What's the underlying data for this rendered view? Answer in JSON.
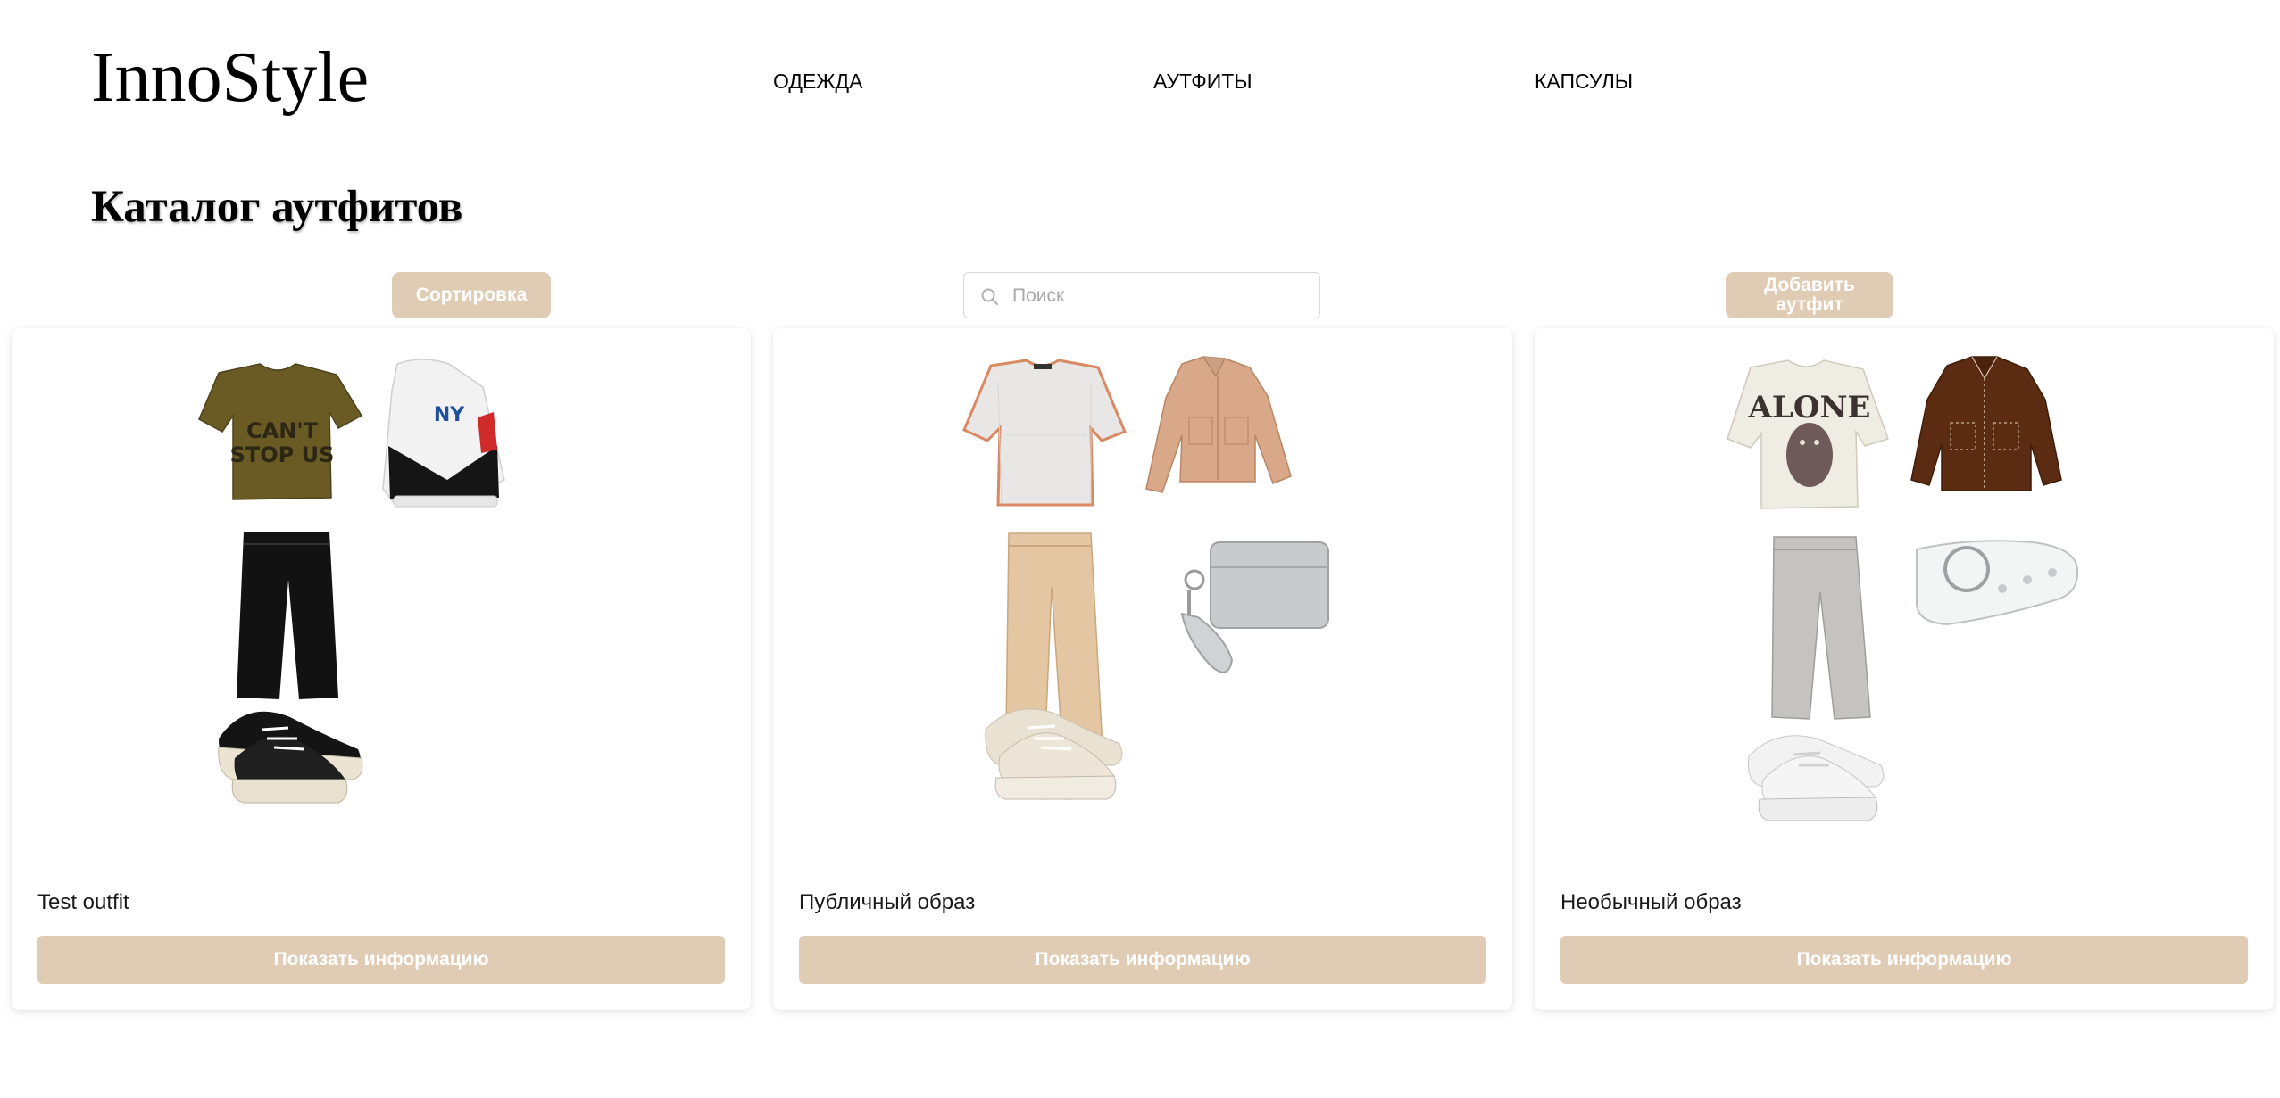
{
  "header": {
    "logo": "InnoStyle",
    "nav": [
      "ОДЕЖДА",
      "АУТФИТЫ",
      "КАПСУЛЫ"
    ]
  },
  "page": {
    "title": "Каталог аутфитов"
  },
  "toolbar": {
    "sort_label": "Сортировка",
    "search_placeholder": "Поиск",
    "search_value": "",
    "add_label": "Добавить аутфит"
  },
  "outfits": [
    {
      "name": "Test outfit",
      "button": "Показать информацию",
      "items": [
        "olive-tshirt-icon",
        "ny-windbreaker-icon",
        "black-jeans-icon",
        "black-sneakers-icon"
      ],
      "print_text": "CAN'T STOP US"
    },
    {
      "name": "Публичный образ",
      "button": "Показать информацию",
      "items": [
        "mesh-top-icon",
        "beige-jacket-icon",
        "beige-trousers-icon",
        "silver-wallet-icon",
        "beige-sneakers-icon"
      ]
    },
    {
      "name": "Необычный образ",
      "button": "Показать информацию",
      "items": [
        "alone-tshirt-icon",
        "brown-jacket-icon",
        "grey-jeans-icon",
        "white-belt-icon",
        "white-sneakers-icon"
      ],
      "print_text": "ALONE"
    }
  ],
  "colors": {
    "accent": "#e0cbb4",
    "text": "#111111",
    "background": "#ffffff"
  }
}
